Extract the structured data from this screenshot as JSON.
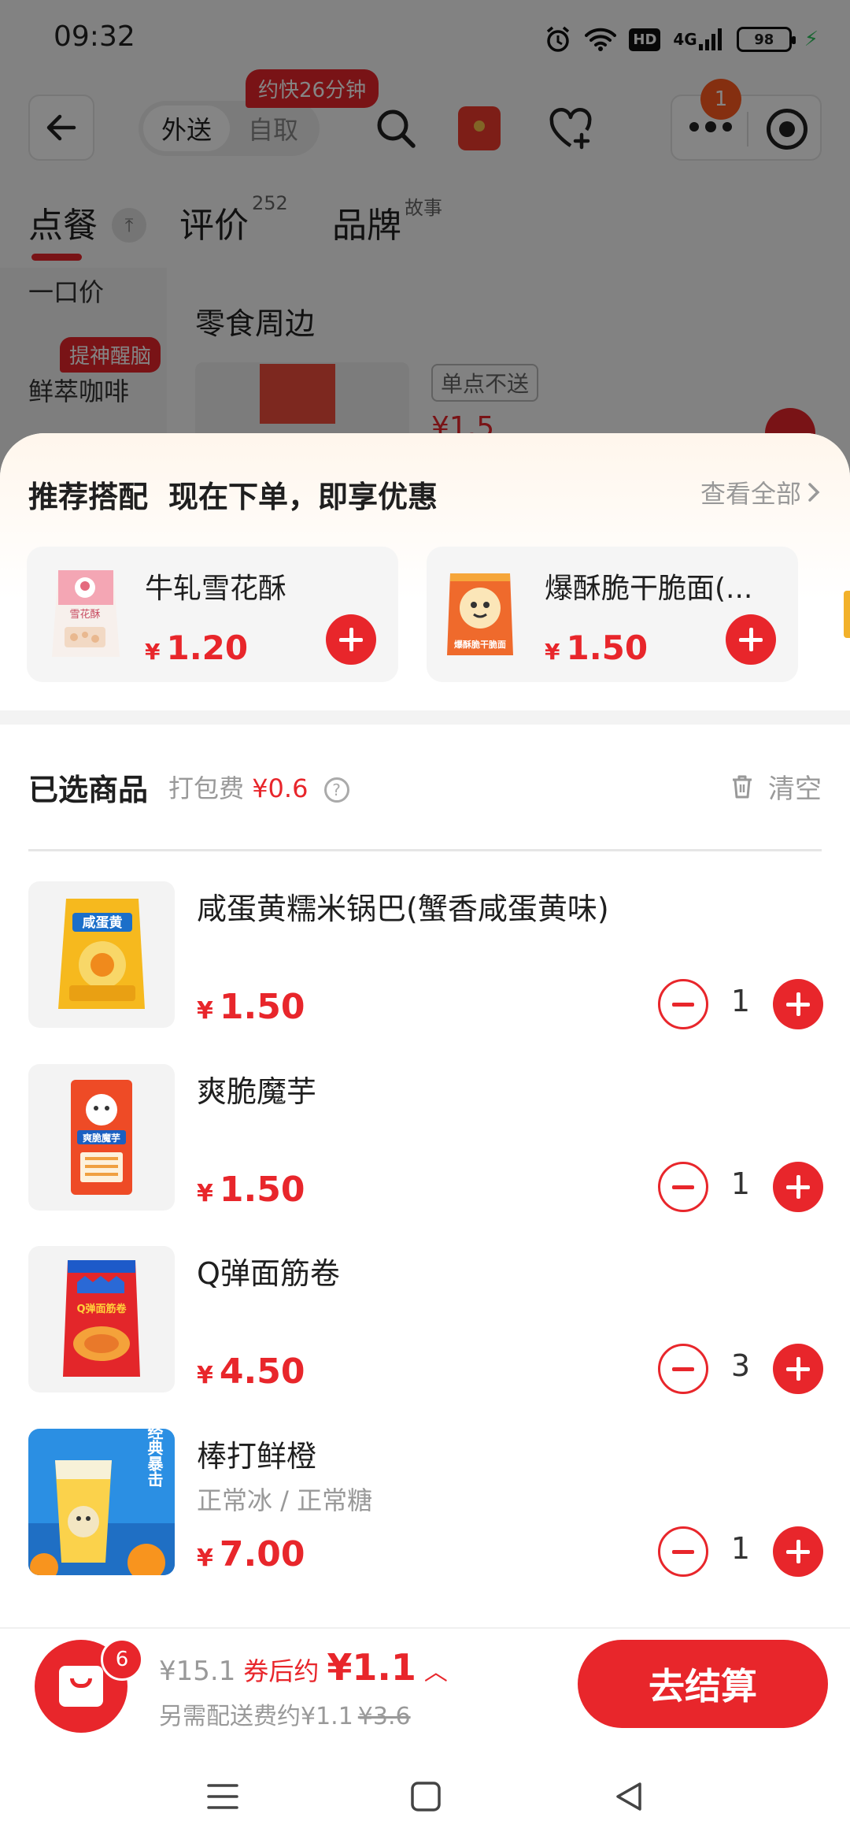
{
  "status_bar": {
    "time": "09:32",
    "hd": "HD",
    "network": "4G",
    "battery": "98"
  },
  "nav": {
    "mode_delivery": "外送",
    "mode_pickup": "自取",
    "eta_badge": "约快26分钟",
    "notif_count": "1"
  },
  "tabs": [
    {
      "label": "点餐",
      "sup": ""
    },
    {
      "label": "评价",
      "sup": "252"
    },
    {
      "label": "品牌",
      "sup": "故事"
    }
  ],
  "left_menu": {
    "item1": "一口价",
    "item2": "鲜萃咖啡",
    "item2_tag": "提神醒脑"
  },
  "background_section": {
    "title": "零食周边",
    "tag": "单点不送",
    "price": "¥1.5"
  },
  "recommend": {
    "title": "推荐搭配",
    "subtitle": "现在下单，即享优惠",
    "view_all": "查看全部",
    "items": [
      {
        "name": "牛轧雪花酥",
        "currency": "¥",
        "price": "1.20"
      },
      {
        "name": "爆酥脆干脆面(...",
        "currency": "¥",
        "price": "1.50"
      }
    ]
  },
  "cart": {
    "title": "已选商品",
    "pack_fee_label": "打包费",
    "pack_fee_value": "¥0.6",
    "help": "?",
    "clear": "清空",
    "items": [
      {
        "name": "咸蛋黄糯米锅巴(蟹香咸蛋黄味)",
        "spec": "",
        "currency": "¥",
        "price": "1.50",
        "qty": "1"
      },
      {
        "name": "爽脆魔芋",
        "spec": "",
        "currency": "¥",
        "price": "1.50",
        "qty": "1"
      },
      {
        "name": "Q弹面筋卷",
        "spec": "",
        "currency": "¥",
        "price": "4.50",
        "qty": "3"
      },
      {
        "name": "棒打鲜橙",
        "spec": "正常冰 / 正常糖",
        "currency": "¥",
        "price": "7.00",
        "qty": "1"
      }
    ]
  },
  "checkout": {
    "bag_count": "6",
    "original_total": "¥15.1",
    "after_coupon_label": "券后约",
    "after_coupon_price": "¥1.1",
    "delivery_note": "另需配送费约¥1.1",
    "delivery_original": "¥3.6",
    "button": "去结算"
  },
  "image_art": {
    "snowflake_label": "雪花酥",
    "noodle_label": "爆酥脆干脆面",
    "guoba_label": "咸蛋黄",
    "konjac_label": "爽脆魔芋",
    "gluten_label": "Q弹面筋卷",
    "orange_label": "经典暴击"
  },
  "colors": {
    "accent": "#e8262b",
    "eta_badge": "#e8262b",
    "notif": "#ff5a1f",
    "charging": "#2ec15e"
  }
}
